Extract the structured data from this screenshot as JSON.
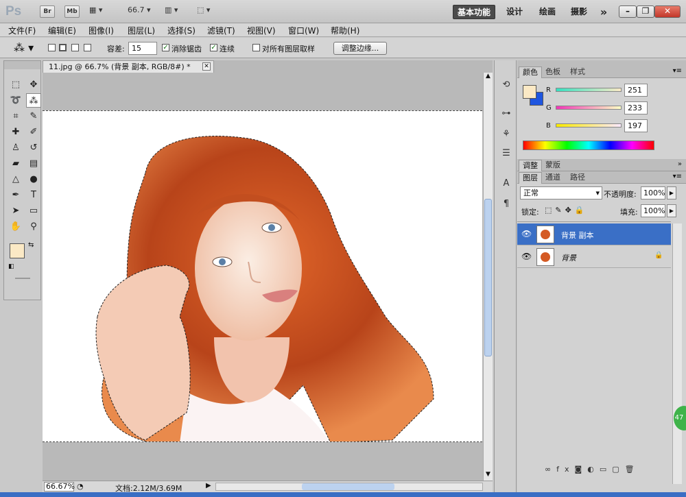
{
  "app": {
    "logo": "Ps"
  },
  "topbar": {
    "bridge": "Br",
    "minibridge": "Mb",
    "zoom_value": "66.7",
    "workspaces": [
      "基本功能",
      "设计",
      "绘画",
      "摄影"
    ],
    "more": "»"
  },
  "menu": [
    "文件(F)",
    "编辑(E)",
    "图像(I)",
    "图层(L)",
    "选择(S)",
    "滤镜(T)",
    "视图(V)",
    "窗口(W)",
    "帮助(H)"
  ],
  "options": {
    "tolerance_label": "容差:",
    "tolerance_value": "15",
    "antialias_label": "消除锯齿",
    "contiguous_label": "连续",
    "sample_all_label": "对所有图层取样",
    "refine_edge_button": "调整边缘..."
  },
  "document": {
    "tab_title": "11.jpg @ 66.7% (背景 副本, RGB/8#) *",
    "status_zoom": "66.67%",
    "status_doc": "文档:2.12M/3.69M"
  },
  "color_panel": {
    "tabs": [
      "颜色",
      "色板",
      "样式"
    ],
    "r_label": "R",
    "g_label": "G",
    "b_label": "B",
    "r": "251",
    "g": "233",
    "b": "197",
    "foreground": "#fbe9c5",
    "background": "#1f56e0"
  },
  "adjust_panel": {
    "tabs": [
      "调整",
      "蒙版"
    ]
  },
  "layers_panel": {
    "tabs": [
      "图层",
      "通道",
      "路径"
    ],
    "blend_mode": "正常",
    "opacity_label": "不透明度:",
    "opacity_value": "100%",
    "lock_label": "锁定:",
    "fill_label": "填充:",
    "fill_value": "100%",
    "layers": [
      {
        "name": "背景 副本",
        "selected": true
      },
      {
        "name": "背景",
        "locked": true
      }
    ]
  },
  "watermark": {
    "badge": "47"
  }
}
